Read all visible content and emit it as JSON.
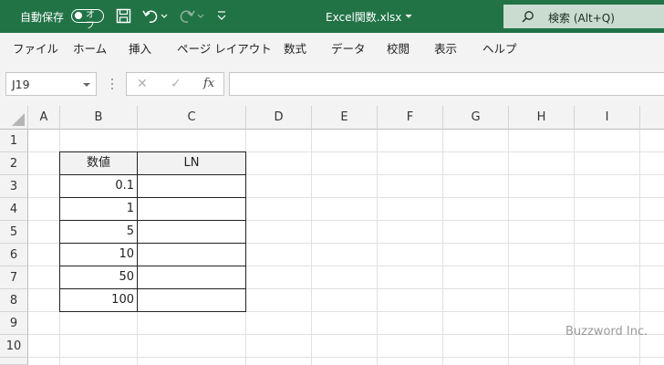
{
  "titlebar": {
    "autosave_label": "自動保存",
    "autosave_state": "オフ",
    "filename": "Excel関数.xlsx",
    "search_placeholder": "検索 (Alt+Q)",
    "bg_color": "#217346"
  },
  "menu": [
    "ファイル",
    "ホーム",
    "挿入",
    "ページ レイアウト",
    "数式",
    "データ",
    "校閲",
    "表示",
    "ヘルプ"
  ],
  "formula_bar": {
    "name_box": "J19",
    "cancel_icon": "✕",
    "enter_icon": "✓",
    "fx_label": "fx",
    "formula": ""
  },
  "sheet": {
    "columns": [
      "A",
      "B",
      "C",
      "D",
      "E",
      "F",
      "G",
      "H",
      "I"
    ],
    "rows": [
      "1",
      "2",
      "3",
      "4",
      "5",
      "6",
      "7",
      "8",
      "9",
      "10"
    ],
    "table": {
      "headers": [
        "数値",
        "LN"
      ],
      "values": [
        "0.1",
        "1",
        "5",
        "10",
        "50",
        "100"
      ]
    }
  },
  "watermark": "Buzzword Inc."
}
